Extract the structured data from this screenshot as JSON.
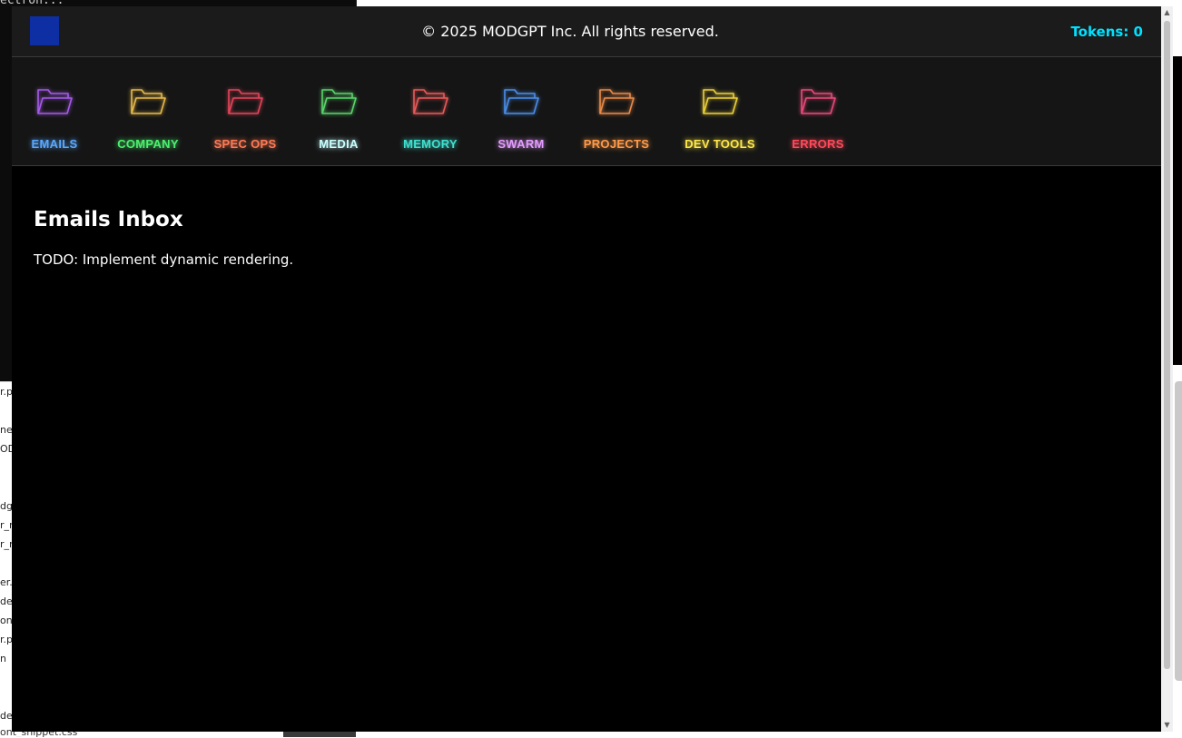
{
  "background": {
    "terminal_text": "ectron...",
    "left_list": [
      "r.p",
      "ne.",
      "OD",
      "dgr",
      "r_n",
      "r_n",
      "er.p",
      "de",
      "on.",
      "r.p",
      "n",
      "de"
    ],
    "bottom_file": "ont_snippet.css"
  },
  "header": {
    "copyright": "© 2025 MODGPT Inc. All rights reserved.",
    "tokens": "Tokens: 0"
  },
  "nav": {
    "items": [
      {
        "label": "EMAILS",
        "icon": "folder-icon",
        "folder_color": "#a55ae8",
        "label_color": "#5aa8ff"
      },
      {
        "label": "COMPANY",
        "icon": "folder-icon",
        "folder_color": "#e6b94a",
        "label_color": "#4cf06e"
      },
      {
        "label": "SPEC OPS",
        "icon": "folder-icon",
        "folder_color": "#e2455a",
        "label_color": "#ff7a55"
      },
      {
        "label": "MEDIA",
        "icon": "folder-icon",
        "folder_color": "#5ad46a",
        "label_color": "#c9ffff"
      },
      {
        "label": "MEMORY",
        "icon": "folder-icon",
        "folder_color": "#e85a5a",
        "label_color": "#3ee0d0"
      },
      {
        "label": "SWARM",
        "icon": "folder-icon",
        "folder_color": "#4a8ee8",
        "label_color": "#e49cff"
      },
      {
        "label": "PROJECTS",
        "icon": "folder-icon",
        "folder_color": "#e88a4a",
        "label_color": "#ff9a4a"
      },
      {
        "label": "DEV TOOLS",
        "icon": "folder-icon",
        "folder_color": "#ecd03a",
        "label_color": "#ffe84a"
      },
      {
        "label": "ERRORS",
        "icon": "folder-icon",
        "folder_color": "#e84a7a",
        "label_color": "#ff4a5a"
      }
    ]
  },
  "main": {
    "title": "Emails Inbox",
    "body": "TODO: Implement dynamic rendering."
  }
}
